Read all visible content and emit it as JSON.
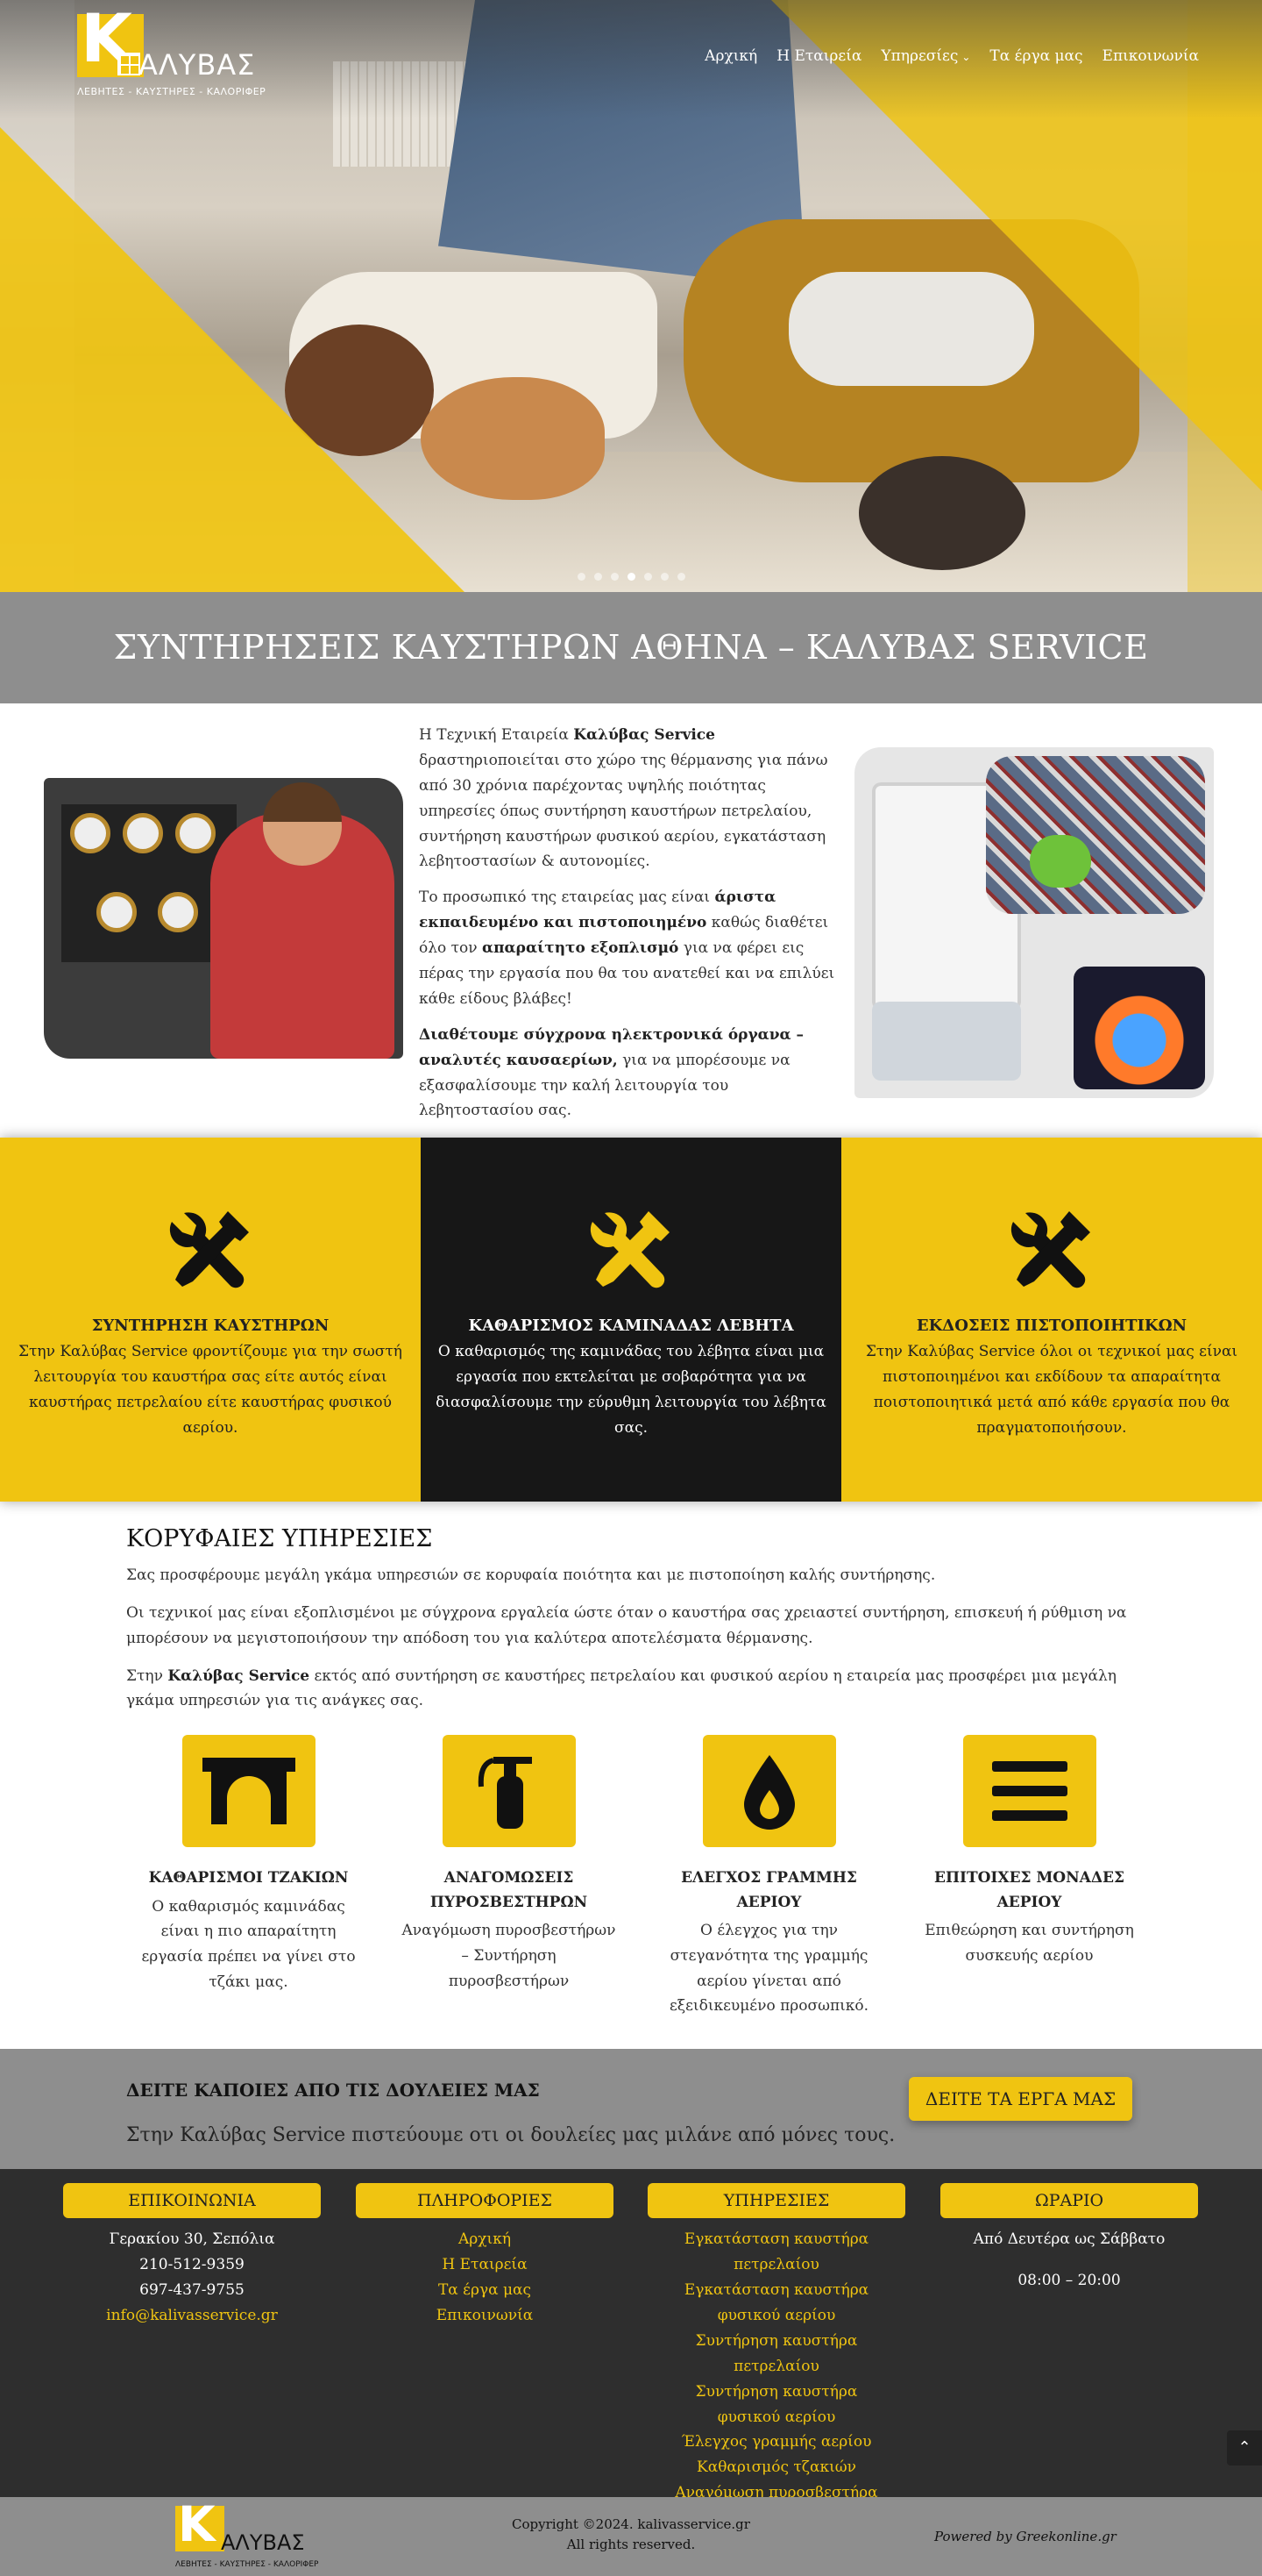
{
  "brand": {
    "logo_letter": "K",
    "logo_name": "ΑΛΥΒΑΣ",
    "logo_tagline": "ΛΕΒΗΤΕΣ - ΚΑΥΣΤΗΡΕΣ - ΚΑΛΟΡΙΦΕΡ",
    "accent": "#f0c411",
    "dark": "#171717",
    "gray": "#8e8e8e"
  },
  "nav": {
    "items": [
      {
        "label": "Αρχική"
      },
      {
        "label": "Η Εταιρεία"
      },
      {
        "label": "Υπηρεσίες",
        "dropdown": true
      },
      {
        "label": "Τα έργα μας"
      },
      {
        "label": "Επικοινωνία"
      }
    ]
  },
  "hero": {
    "slides": 7,
    "active_slide": 4
  },
  "title_band": {
    "title": "ΣΥΝΤΗΡΗΣΕΙΣ ΚΑΥΣΤΗΡΩΝ ΑΘΗΝΑ – ΚΑΛΥΒΑΣ SERVICE"
  },
  "intro": {
    "p1_a": "Η Τεχνική Εταιρεία ",
    "p1_b": "Καλύβας Service",
    "p1_c": " δραστηριοποιείται στο χώρο της θέρμανσης για πάνω από 30 χρόνια παρέχοντας υψηλής ποιότητας υπηρεσίες όπως συντήρηση καυστήρων πετρελαίου,  συντήρηση καυστήρων φυσικού αερίου, εγκατάσταση λεβητοστασίων & αυτονομίες.",
    "p2_a": "Το προσωπικό της εταιρείας μας είναι ",
    "p2_b": "άριστα εκπαιδευμένο  και πιστοποιημένο",
    "p2_c": " καθώς διαθέτει όλο τον ",
    "p2_d": "απαραίτητο εξοπλισμό",
    "p2_e": " για να φέρει εις πέρας την εργασία που θα του ανατεθεί και να επιλύει κάθε είδους βλάβες!",
    "p3_a": "Διαθέτουμε σύγχρονα ηλεκτρονικά όργανα – αναλυτές καυσαερίων,",
    "p3_b": " για να μπορέσουμε να εξασφαλίσουμε την καλή λειτουργία του λεβητοστασίου σας."
  },
  "features": [
    {
      "title": "ΣΥΝΤΗΡΗΣΗ ΚΑΥΣΤΗΡΩΝ",
      "text": "Στην Καλύβας Service φροντίζουμε για την σωστή λειτουργία του καυστήρα σας είτε αυτός είναι καυστήρας πετρελαίου είτε καυστήρας φυσικού αερίου.",
      "icon": "tools-icon"
    },
    {
      "title": "ΚΑΘΑΡΙΣΜΟΣ ΚΑΜΙΝΑΔΑΣ ΛΕΒΗΤΑ",
      "text": "Ο καθαρισμός της καμινάδας του λέβητα είναι μια εργασία που εκτελείται με σοβαρότητα για να διασφαλίσουμε την εύρυθμη λειτουργία του λέβητα σας.",
      "icon": "tools-icon"
    },
    {
      "title": "ΕΚΔΟΣΕΙΣ ΠΙΣΤΟΠΟΙΗΤΙΚΩΝ",
      "text": "Στην Καλύβας Service όλοι οι τεχνικοί μας είναι πιστοποιημένοι και εκδίδουν τα απαραίτητα ποιστοποιητικά μετά από κάθε εργασία που θα πραγματοποιήσουν.",
      "icon": "tools-icon"
    }
  ],
  "top_services": {
    "heading": "ΚΟΡΥΦΑΙΕΣ ΥΠΗΡΕΣΙΕΣ",
    "p1": "Σας προσφέρουμε μεγάλη γκάμα υπηρεσιών σε κορυφαία ποιότητα και με πιστοποίηση καλής συντήρησης.",
    "p2": "Οι τεχνικοί μας είναι εξοπλισμένοι με σύγχρονα εργαλεία ώστε όταν ο καυστήρα σας χρειαστεί συντήρηση, επισκευή ή ρύθμιση να μπορέσουν να μεγιστοποιήσουν την απόδοση του για καλύτερα αποτελέσματα θέρμανσης.",
    "p3_a": "Στην ",
    "p3_b": "Καλύβας Service",
    "p3_c": " εκτός από συντήρηση σε καυστήρες πετρελαίου και φυσικού αερίου η εταιρεία μας προσφέρει μια μεγάλη γκάμα υπηρεσιών για τις ανάγκες σας.",
    "items": [
      {
        "title": "ΚΑΘΑΡΙΣΜΟΙ ΤΖΑΚΙΩΝ",
        "text": "Ο καθαρισμός καμινάδας είναι η πιο απαραίτητη εργασία πρέπει να γίνει στο τζάκι μας.",
        "icon": "fireplace-icon"
      },
      {
        "title": "ΑΝΑΓΟΜΩΣΕΙΣ ΠΥΡΟΣΒΕΣΤΗΡΩΝ",
        "text": "Αναγόμωση πυροσβεστήρων – Συντήρηση πυροσβεστήρων",
        "icon": "fire-extinguisher-icon"
      },
      {
        "title": "ΕΛΕΓΧΟΣ ΓΡΑΜΜΗΣ ΑΕΡΙΟΥ",
        "text": "Ο έλεγχος για την στεγανότητα της γραμμής αερίου γίνεται από εξειδικευμένο προσωπικό.",
        "icon": "drop-icon"
      },
      {
        "title": "ΕΠΙΤΟΙΧΕΣ ΜΟΝΑΔΕΣ ΑΕΡΙΟΥ",
        "text": "Επιθεώρηση και συντήρηση συσκευής αερίου",
        "icon": "bars-icon"
      }
    ]
  },
  "cta": {
    "heading": "ΔΕΙΤΕ ΚΑΠΟΙΕΣ ΑΠΟ ΤΙΣ ΔΟΥΛΕΙΕΣ ΜΑΣ",
    "text": "Στην Καλύβας Service πιστεύουμε οτι οι δουλείες μας μιλάνε από μόνες τους.",
    "button": "ΔΕΙΤΕ ΤΑ ΕΡΓΑ ΜΑΣ"
  },
  "footer": {
    "contact": {
      "heading": "ΕΠΙΚΟΙΝΩΝΙΑ",
      "address": "Γερακίου 30, Σεπόλια",
      "phone1": "210-512-9359",
      "phone2": "697-437-9755",
      "email": "info@kalivasservice.gr"
    },
    "info": {
      "heading": "ΠΛΗΡΟΦΟΡΙΕΣ",
      "links": [
        "Αρχική",
        "Η Εταιρεία",
        "Τα έργα μας",
        "Επικοινωνία"
      ]
    },
    "services": {
      "heading": "ΥΠΗΡΕΣΙΕΣ",
      "links": [
        "Εγκατάσταση καυστήρα πετρελαίου",
        "Εγκατάσταση καυστήρα φυσικού αερίου",
        "Συντήρηση καυστήρα πετρελαίου",
        "Συντήρηση καυστήρα φυσικού αερίου",
        "Έλεγχος γραμμής αερίου",
        "Καθαρισμός τζακιών",
        "Αναγόμωση πυροσβεστήρα"
      ]
    },
    "hours": {
      "heading": "ΩΡΑΡΙΟ",
      "days": "Από Δευτέρα ως Σάββατο",
      "time": "08:00 – 20:00"
    }
  },
  "bottom": {
    "copyright": "Copyright ©2024. kalivasservice.gr",
    "rights": "All rights reserved.",
    "powered": "Powered by Greekonline.gr"
  }
}
